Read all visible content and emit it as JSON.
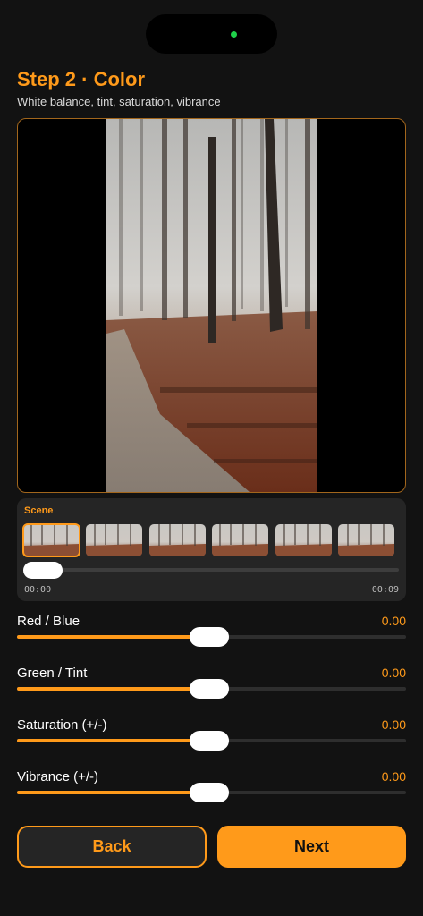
{
  "header": {
    "title": "Step 2 · Color",
    "subtitle": "White balance, tint, saturation, vibrance"
  },
  "scene": {
    "label": "Scene",
    "selected_index": 0,
    "thumbnail_count": 6,
    "position": 0.0,
    "time_start": "00:00",
    "time_end": "00:09"
  },
  "adjustments": [
    {
      "label": "Red / Blue",
      "value": "0.00",
      "level": 0.5
    },
    {
      "label": "Green / Tint",
      "value": "0.00",
      "level": 0.5
    },
    {
      "label": "Saturation (+/-)",
      "value": "0.00",
      "level": 0.5
    },
    {
      "label": "Vibrance (+/-)",
      "value": "0.00",
      "level": 0.5
    }
  ],
  "actions": {
    "back_label": "Back",
    "next_label": "Next"
  },
  "colors": {
    "accent": "#ff9a1a",
    "background": "#121212",
    "panel": "#252525"
  },
  "icons": {
    "camera_dot": "front-camera-indicator"
  }
}
